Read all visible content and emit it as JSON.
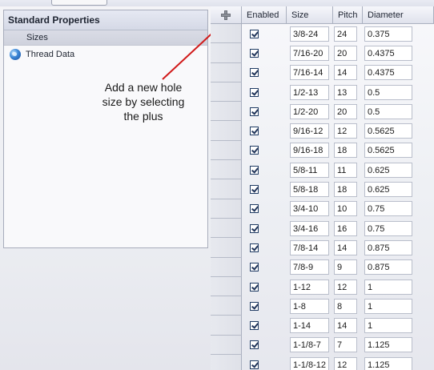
{
  "panel": {
    "title": "Standard Properties",
    "items": [
      {
        "label": "Sizes",
        "icon": null
      },
      {
        "label": "Thread Data",
        "icon": "globe-icon"
      }
    ]
  },
  "annotation": {
    "line1": "Add a new hole",
    "line2": "size by selecting",
    "line3": "the plus",
    "arrow_color": "#d11a1a"
  },
  "grid": {
    "add_icon": "plus-icon",
    "columns": [
      "Enabled",
      "Size",
      "Pitch",
      "Diameter"
    ],
    "rows": [
      {
        "enabled": true,
        "size": "3/8-24",
        "pitch": "24",
        "diameter": "0.375"
      },
      {
        "enabled": true,
        "size": "7/16-20",
        "pitch": "20",
        "diameter": "0.4375"
      },
      {
        "enabled": true,
        "size": "7/16-14",
        "pitch": "14",
        "diameter": "0.4375"
      },
      {
        "enabled": true,
        "size": "1/2-13",
        "pitch": "13",
        "diameter": "0.5"
      },
      {
        "enabled": true,
        "size": "1/2-20",
        "pitch": "20",
        "diameter": "0.5"
      },
      {
        "enabled": true,
        "size": "9/16-12",
        "pitch": "12",
        "diameter": "0.5625"
      },
      {
        "enabled": true,
        "size": "9/16-18",
        "pitch": "18",
        "diameter": "0.5625"
      },
      {
        "enabled": true,
        "size": "5/8-11",
        "pitch": "11",
        "diameter": "0.625"
      },
      {
        "enabled": true,
        "size": "5/8-18",
        "pitch": "18",
        "diameter": "0.625"
      },
      {
        "enabled": true,
        "size": "3/4-10",
        "pitch": "10",
        "diameter": "0.75"
      },
      {
        "enabled": true,
        "size": "3/4-16",
        "pitch": "16",
        "diameter": "0.75"
      },
      {
        "enabled": true,
        "size": "7/8-14",
        "pitch": "14",
        "diameter": "0.875"
      },
      {
        "enabled": true,
        "size": "7/8-9",
        "pitch": "9",
        "diameter": "0.875"
      },
      {
        "enabled": true,
        "size": "1-12",
        "pitch": "12",
        "diameter": "1"
      },
      {
        "enabled": true,
        "size": "1-8",
        "pitch": "8",
        "diameter": "1"
      },
      {
        "enabled": true,
        "size": "1-14",
        "pitch": "14",
        "diameter": "1"
      },
      {
        "enabled": true,
        "size": "1-1/8-7",
        "pitch": "7",
        "diameter": "1.125"
      },
      {
        "enabled": true,
        "size": "1-1/8-12",
        "pitch": "12",
        "diameter": "1.125"
      }
    ]
  }
}
